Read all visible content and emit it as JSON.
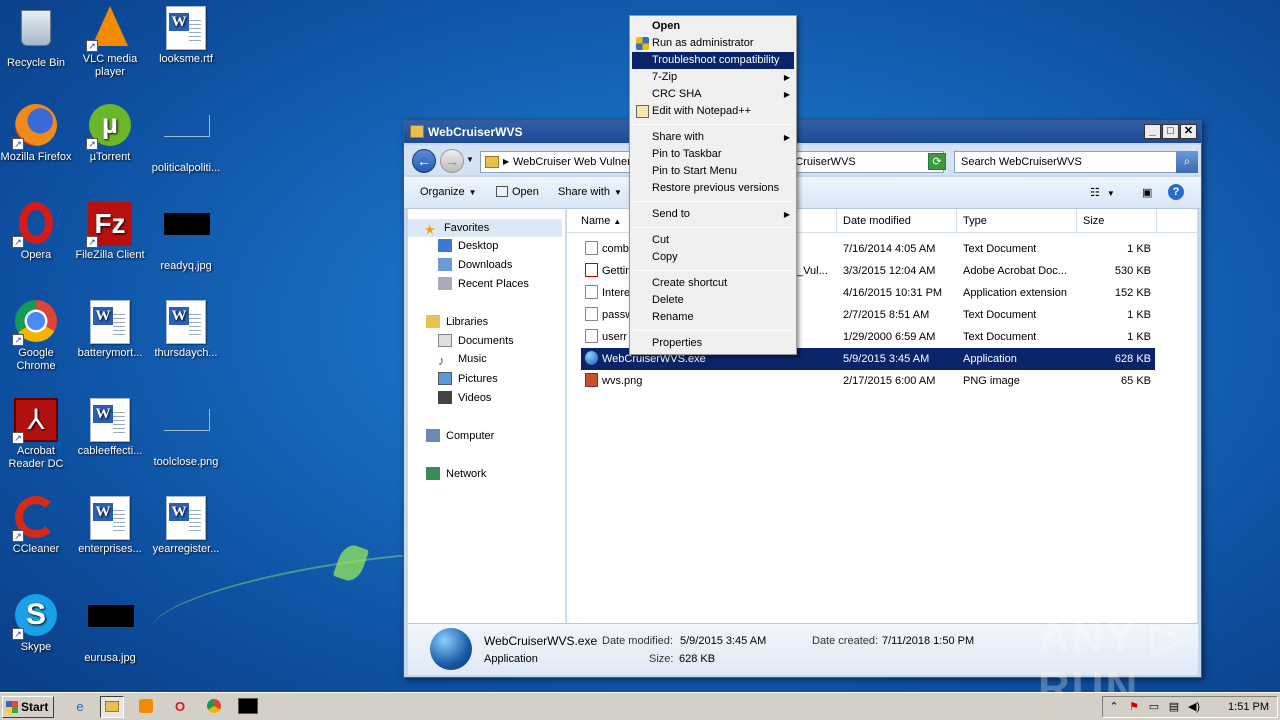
{
  "desktop": {
    "icons": [
      {
        "label": "Recycle Bin"
      },
      {
        "label": "VLC media player"
      },
      {
        "label": "looksme.rtf"
      },
      {
        "label": "Mozilla Firefox"
      },
      {
        "label": "µTorrent"
      },
      {
        "label": "politicalpoliti..."
      },
      {
        "label": "Opera"
      },
      {
        "label": "FileZilla Client"
      },
      {
        "label": "readyq.jpg"
      },
      {
        "label": "Google Chrome"
      },
      {
        "label": "batterymort..."
      },
      {
        "label": "thursdaych..."
      },
      {
        "label": "Acrobat Reader DC"
      },
      {
        "label": "cableeffecti..."
      },
      {
        "label": "toolclose.png"
      },
      {
        "label": "CCleaner"
      },
      {
        "label": "enterprises..."
      },
      {
        "label": "yearregister..."
      },
      {
        "label": "Skype"
      },
      {
        "label": "eurusa.jpg"
      }
    ]
  },
  "window": {
    "title": "WebCruiserWVS",
    "address_crumb1": "WebCruiser Web Vulner",
    "address_crumb2": "ebCruiserWVS",
    "search_placeholder": "Search WebCruiserWVS",
    "toolbar": {
      "organize": "Organize",
      "open": "Open",
      "share_with": "Share with"
    },
    "nav": {
      "favorites": "Favorites",
      "desktop": "Desktop",
      "downloads": "Downloads",
      "recent_places": "Recent Places",
      "libraries": "Libraries",
      "documents": "Documents",
      "music": "Music",
      "pictures": "Pictures",
      "videos": "Videos",
      "computer": "Computer",
      "network": "Network"
    },
    "columns": {
      "name": "Name",
      "date_modified": "Date modified",
      "type": "Type",
      "size": "Size"
    },
    "files": [
      {
        "name": "comb",
        "extra": "",
        "date": "7/16/2014 4:05 AM",
        "type": "Text Document",
        "size": "1 KB"
      },
      {
        "name": "Gettin",
        "extra": "_Vul...",
        "date": "3/3/2015 12:04 AM",
        "type": "Adobe Acrobat Doc...",
        "size": "530 KB"
      },
      {
        "name": "Intere",
        "extra": "",
        "date": "4/16/2015 10:31 PM",
        "type": "Application extension",
        "size": "152 KB"
      },
      {
        "name": "passw",
        "extra": "",
        "date": "2/7/2015 8:51 AM",
        "type": "Text Document",
        "size": "1 KB"
      },
      {
        "name": "userr",
        "extra": "",
        "date": "1/29/2000 6:59 AM",
        "type": "Text Document",
        "size": "1 KB"
      },
      {
        "name": "WebCruiserWVS.exe",
        "extra": "",
        "date": "5/9/2015 3:45 AM",
        "type": "Application",
        "size": "628 KB"
      },
      {
        "name": "wvs.png",
        "extra": "",
        "date": "2/17/2015 6:00 AM",
        "type": "PNG image",
        "size": "65 KB"
      }
    ],
    "details": {
      "filename": "WebCruiserWVS.exe",
      "date_modified_label": "Date modified:",
      "date_modified": "5/9/2015 3:45 AM",
      "date_created_label": "Date created:",
      "date_created": "7/11/2018 1:50 PM",
      "type": "Application",
      "size_label": "Size:",
      "size": "628 KB"
    }
  },
  "context_menu": {
    "open": "Open",
    "run_as_admin": "Run as administrator",
    "troubleshoot": "Troubleshoot compatibility",
    "seven_zip": "7-Zip",
    "crc_sha": "CRC SHA",
    "edit_notepad": "Edit with Notepad++",
    "share_with": "Share with",
    "pin_taskbar": "Pin to Taskbar",
    "pin_start": "Pin to Start Menu",
    "restore_versions": "Restore previous versions",
    "send_to": "Send to",
    "cut": "Cut",
    "copy": "Copy",
    "create_shortcut": "Create shortcut",
    "delete": "Delete",
    "rename": "Rename",
    "properties": "Properties"
  },
  "taskbar": {
    "start": "Start",
    "clock": "1:51 PM"
  },
  "watermark": "ANY RUN"
}
